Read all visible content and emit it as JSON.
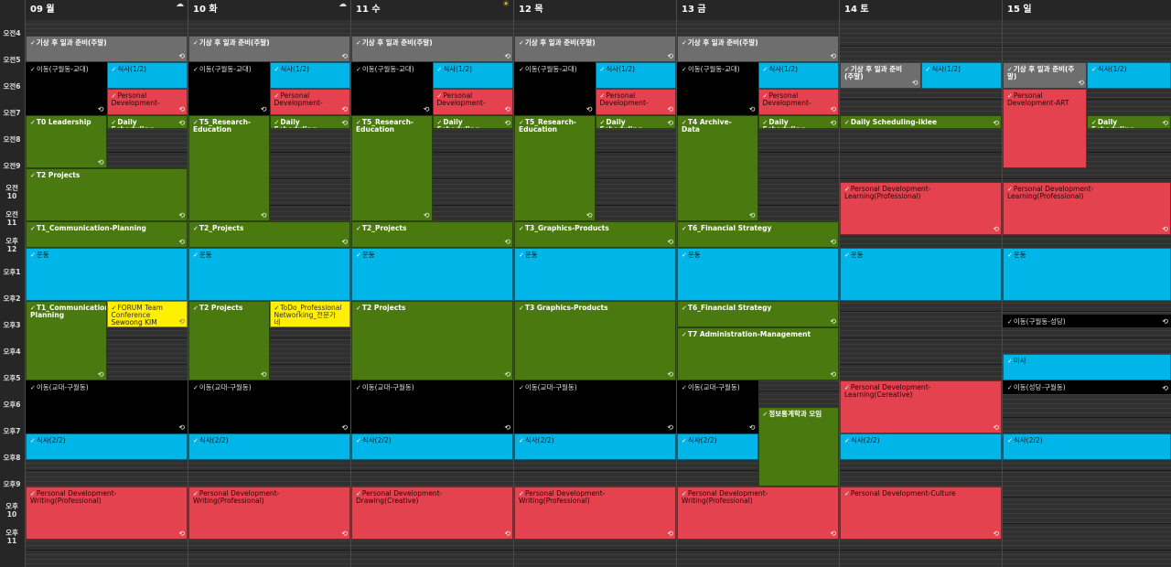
{
  "days": [
    {
      "label": "09 월",
      "weather": "cloud-icon"
    },
    {
      "label": "10 화",
      "weather": "cloud-icon"
    },
    {
      "label": "11 수",
      "weather": "sun-icon"
    },
    {
      "label": "12 목",
      "weather": ""
    },
    {
      "label": "13 금",
      "weather": ""
    },
    {
      "label": "14 토",
      "weather": ""
    },
    {
      "label": "15 일",
      "weather": ""
    }
  ],
  "hours": [
    "오전4",
    "오전5",
    "오전6",
    "오전7",
    "오전8",
    "오전9",
    "오전\n10",
    "오전\n11",
    "오후\n12",
    "오후1",
    "오후2",
    "오후3",
    "오후4",
    "오후5",
    "오후6",
    "오후7",
    "오후8",
    "오후9",
    "오후\n10",
    "오후\n11"
  ],
  "colors": {
    "gray": "#6e6e6e",
    "black": "#000000",
    "blue": "#00b6e9",
    "red": "#e5424f",
    "green": "#4a7a0f",
    "yellow": "#ffef00"
  },
  "icons": {
    "check": "check-icon",
    "sync": "sync-icon"
  },
  "events": [
    {
      "day": 0,
      "start": 4.6,
      "end": 5.6,
      "col": 0,
      "cols": 1,
      "color": "gray",
      "title": "기상 후 일과 준비(주말)",
      "sync": true
    },
    {
      "day": 0,
      "start": 5.6,
      "end": 7.6,
      "col": 0,
      "cols": 2,
      "color": "black",
      "title": "이동(구월동-교대)",
      "sync": true
    },
    {
      "day": 0,
      "start": 5.6,
      "end": 6.6,
      "col": 1,
      "cols": 2,
      "color": "blue",
      "title": "식사(1/2)",
      "sync": false
    },
    {
      "day": 0,
      "start": 6.6,
      "end": 7.6,
      "col": 1,
      "cols": 2,
      "color": "red",
      "title": "Personal Development-",
      "sync": true
    },
    {
      "day": 0,
      "start": 7.6,
      "end": 9.6,
      "col": 0,
      "cols": 2,
      "color": "green",
      "title": "T0 Leadership",
      "sync": true
    },
    {
      "day": 0,
      "start": 7.6,
      "end": 8.1,
      "col": 1,
      "cols": 2,
      "color": "green",
      "title": "Daily Scheduling",
      "sync": true
    },
    {
      "day": 0,
      "start": 9.6,
      "end": 11.6,
      "col": 0,
      "cols": 1,
      "color": "green",
      "title": "T2 Projects",
      "sync": true
    },
    {
      "day": 0,
      "start": 11.6,
      "end": 12.6,
      "col": 0,
      "cols": 1,
      "color": "green",
      "title": "T1_Communication-Planning",
      "sync": true
    },
    {
      "day": 0,
      "start": 12.6,
      "end": 14.6,
      "col": 0,
      "cols": 1,
      "color": "blue",
      "title": "운동",
      "sync": false
    },
    {
      "day": 0,
      "start": 14.6,
      "end": 17.6,
      "col": 0,
      "cols": 2,
      "color": "green",
      "title": "T1_Communication-Planning",
      "sync": true
    },
    {
      "day": 0,
      "start": 14.6,
      "end": 15.6,
      "col": 1,
      "cols": 2,
      "color": "yellow",
      "title": "FORUM Team Conference",
      "sub": "Sewoong KIM",
      "sync": true
    },
    {
      "day": 0,
      "start": 17.6,
      "end": 19.6,
      "col": 0,
      "cols": 1,
      "color": "black",
      "title": "이동(교대-구월동)",
      "sync": true
    },
    {
      "day": 0,
      "start": 19.6,
      "end": 20.6,
      "col": 0,
      "cols": 1,
      "color": "blue",
      "title": "식사(2/2)",
      "sync": false
    },
    {
      "day": 0,
      "start": 21.6,
      "end": 23.6,
      "col": 0,
      "cols": 1,
      "color": "red",
      "title": "Personal Development-Writing(Professional)",
      "sync": true
    },
    {
      "day": 1,
      "start": 4.6,
      "end": 5.6,
      "col": 0,
      "cols": 1,
      "color": "gray",
      "title": "기상 후 일과 준비(주말)",
      "sync": true
    },
    {
      "day": 1,
      "start": 5.6,
      "end": 7.6,
      "col": 0,
      "cols": 2,
      "color": "black",
      "title": "이동(구월동-교대)",
      "sync": true
    },
    {
      "day": 1,
      "start": 5.6,
      "end": 6.6,
      "col": 1,
      "cols": 2,
      "color": "blue",
      "title": "식사(1/2)",
      "sync": false
    },
    {
      "day": 1,
      "start": 6.6,
      "end": 7.6,
      "col": 1,
      "cols": 2,
      "color": "red",
      "title": "Personal Development-",
      "sync": true
    },
    {
      "day": 1,
      "start": 7.6,
      "end": 11.6,
      "col": 0,
      "cols": 2,
      "color": "green",
      "title": "T5_Research-Education",
      "sync": true
    },
    {
      "day": 1,
      "start": 7.6,
      "end": 8.1,
      "col": 1,
      "cols": 2,
      "color": "green",
      "title": "Daily Scheduling",
      "sync": true
    },
    {
      "day": 1,
      "start": 11.6,
      "end": 12.6,
      "col": 0,
      "cols": 1,
      "color": "green",
      "title": "T2_Projects",
      "sync": true
    },
    {
      "day": 1,
      "start": 12.6,
      "end": 14.6,
      "col": 0,
      "cols": 1,
      "color": "blue",
      "title": "운동",
      "sync": false
    },
    {
      "day": 1,
      "start": 14.6,
      "end": 17.6,
      "col": 0,
      "cols": 2,
      "color": "green",
      "title": "T2 Projects",
      "sync": true
    },
    {
      "day": 1,
      "start": 14.6,
      "end": 15.6,
      "col": 1,
      "cols": 2,
      "color": "yellow",
      "title": "ToDo_Professional Networking_전문가네",
      "sync": false
    },
    {
      "day": 1,
      "start": 17.6,
      "end": 19.6,
      "col": 0,
      "cols": 1,
      "color": "black",
      "title": "이동(교대-구월동)",
      "sync": true
    },
    {
      "day": 1,
      "start": 19.6,
      "end": 20.6,
      "col": 0,
      "cols": 1,
      "color": "blue",
      "title": "식사(2/2)",
      "sync": false
    },
    {
      "day": 1,
      "start": 21.6,
      "end": 23.6,
      "col": 0,
      "cols": 1,
      "color": "red",
      "title": "Personal Development-Writing(Professional)",
      "sync": true
    },
    {
      "day": 2,
      "start": 4.6,
      "end": 5.6,
      "col": 0,
      "cols": 1,
      "color": "gray",
      "title": "기상 후 일과 준비(주말)",
      "sync": true
    },
    {
      "day": 2,
      "start": 5.6,
      "end": 7.6,
      "col": 0,
      "cols": 2,
      "color": "black",
      "title": "이동(구월동-교대)",
      "sync": true
    },
    {
      "day": 2,
      "start": 5.6,
      "end": 6.6,
      "col": 1,
      "cols": 2,
      "color": "blue",
      "title": "식사(1/2)",
      "sync": false
    },
    {
      "day": 2,
      "start": 6.6,
      "end": 7.6,
      "col": 1,
      "cols": 2,
      "color": "red",
      "title": "Personal Development-",
      "sync": true
    },
    {
      "day": 2,
      "start": 7.6,
      "end": 11.6,
      "col": 0,
      "cols": 2,
      "color": "green",
      "title": "T5_Research-Education",
      "sync": true
    },
    {
      "day": 2,
      "start": 7.6,
      "end": 8.1,
      "col": 1,
      "cols": 2,
      "color": "green",
      "title": "Daily Scheduling",
      "sync": true
    },
    {
      "day": 2,
      "start": 11.6,
      "end": 12.6,
      "col": 0,
      "cols": 1,
      "color": "green",
      "title": "T2_Projects",
      "sync": true
    },
    {
      "day": 2,
      "start": 12.6,
      "end": 14.6,
      "col": 0,
      "cols": 1,
      "color": "blue",
      "title": "운동",
      "sync": false
    },
    {
      "day": 2,
      "start": 14.6,
      "end": 17.6,
      "col": 0,
      "cols": 1,
      "color": "green",
      "title": "T2 Projects",
      "sync": true
    },
    {
      "day": 2,
      "start": 17.6,
      "end": 19.6,
      "col": 0,
      "cols": 1,
      "color": "black",
      "title": "이동(교대-구월동)",
      "sync": true
    },
    {
      "day": 2,
      "start": 19.6,
      "end": 20.6,
      "col": 0,
      "cols": 1,
      "color": "blue",
      "title": "식사(2/2)",
      "sync": false
    },
    {
      "day": 2,
      "start": 21.6,
      "end": 23.6,
      "col": 0,
      "cols": 1,
      "color": "red",
      "title": "Personal Development-Drawing(Creative)",
      "sync": true
    },
    {
      "day": 3,
      "start": 4.6,
      "end": 5.6,
      "col": 0,
      "cols": 1,
      "color": "gray",
      "title": "기상 후 일과 준비(주말)",
      "sync": true
    },
    {
      "day": 3,
      "start": 5.6,
      "end": 7.6,
      "col": 0,
      "cols": 2,
      "color": "black",
      "title": "이동(구월동-교대)",
      "sync": true
    },
    {
      "day": 3,
      "start": 5.6,
      "end": 6.6,
      "col": 1,
      "cols": 2,
      "color": "blue",
      "title": "식사(1/2)",
      "sync": false
    },
    {
      "day": 3,
      "start": 6.6,
      "end": 7.6,
      "col": 1,
      "cols": 2,
      "color": "red",
      "title": "Personal Development-",
      "sync": true
    },
    {
      "day": 3,
      "start": 7.6,
      "end": 11.6,
      "col": 0,
      "cols": 2,
      "color": "green",
      "title": "T5_Research-Education",
      "sync": true
    },
    {
      "day": 3,
      "start": 7.6,
      "end": 8.1,
      "col": 1,
      "cols": 2,
      "color": "green",
      "title": "Daily Scheduling",
      "sync": true
    },
    {
      "day": 3,
      "start": 11.6,
      "end": 12.6,
      "col": 0,
      "cols": 1,
      "color": "green",
      "title": "T3_Graphics-Products",
      "sync": true
    },
    {
      "day": 3,
      "start": 12.6,
      "end": 14.6,
      "col": 0,
      "cols": 1,
      "color": "blue",
      "title": "운동",
      "sync": false
    },
    {
      "day": 3,
      "start": 14.6,
      "end": 17.6,
      "col": 0,
      "cols": 1,
      "color": "green",
      "title": "T3 Graphics-Products",
      "sync": true
    },
    {
      "day": 3,
      "start": 17.6,
      "end": 19.6,
      "col": 0,
      "cols": 1,
      "color": "black",
      "title": "이동(교대-구월동)",
      "sync": true
    },
    {
      "day": 3,
      "start": 19.6,
      "end": 20.6,
      "col": 0,
      "cols": 1,
      "color": "blue",
      "title": "식사(2/2)",
      "sync": false
    },
    {
      "day": 3,
      "start": 21.6,
      "end": 23.6,
      "col": 0,
      "cols": 1,
      "color": "red",
      "title": "Personal Development-Writing(Professional)",
      "sync": true
    },
    {
      "day": 4,
      "start": 4.6,
      "end": 5.6,
      "col": 0,
      "cols": 1,
      "color": "gray",
      "title": "기상 후 일과 준비(주말)",
      "sync": true
    },
    {
      "day": 4,
      "start": 5.6,
      "end": 7.6,
      "col": 0,
      "cols": 2,
      "color": "black",
      "title": "이동(구월동-교대)",
      "sync": true
    },
    {
      "day": 4,
      "start": 5.6,
      "end": 6.6,
      "col": 1,
      "cols": 2,
      "color": "blue",
      "title": "식사(1/2)",
      "sync": false
    },
    {
      "day": 4,
      "start": 6.6,
      "end": 7.6,
      "col": 1,
      "cols": 2,
      "color": "red",
      "title": "Personal Development-",
      "sync": true
    },
    {
      "day": 4,
      "start": 7.6,
      "end": 11.6,
      "col": 0,
      "cols": 2,
      "color": "green",
      "title": "T4 Archive-Data",
      "sync": true
    },
    {
      "day": 4,
      "start": 7.6,
      "end": 8.1,
      "col": 1,
      "cols": 2,
      "color": "green",
      "title": "Daily Scheduling",
      "sync": true
    },
    {
      "day": 4,
      "start": 11.6,
      "end": 12.6,
      "col": 0,
      "cols": 1,
      "color": "green",
      "title": "T6_Financial Strategy",
      "sync": true
    },
    {
      "day": 4,
      "start": 12.6,
      "end": 14.6,
      "col": 0,
      "cols": 1,
      "color": "blue",
      "title": "운동",
      "sync": false
    },
    {
      "day": 4,
      "start": 14.6,
      "end": 15.6,
      "col": 0,
      "cols": 1,
      "color": "green",
      "title": "T6_Financial Strategy",
      "sync": true
    },
    {
      "day": 4,
      "start": 15.6,
      "end": 17.6,
      "col": 0,
      "cols": 1,
      "color": "green",
      "title": "T7 Administration-Management",
      "sync": true
    },
    {
      "day": 4,
      "start": 17.6,
      "end": 19.6,
      "col": 0,
      "cols": 2,
      "color": "black",
      "title": "이동(교대-구월동)",
      "sync": true
    },
    {
      "day": 4,
      "start": 18.6,
      "end": 21.6,
      "col": 1,
      "cols": 2,
      "color": "green",
      "title": "정보통계학과 모임",
      "sync": false
    },
    {
      "day": 4,
      "start": 19.6,
      "end": 20.6,
      "col": 0,
      "cols": 2,
      "color": "blue",
      "title": "식사(2/2)",
      "sync": false
    },
    {
      "day": 4,
      "start": 21.6,
      "end": 23.6,
      "col": 0,
      "cols": 1,
      "color": "red",
      "title": "Personal Development-Writing(Professional)",
      "sync": true
    },
    {
      "day": 5,
      "start": 5.6,
      "end": 6.6,
      "col": 0,
      "cols": 2,
      "color": "gray",
      "title": "기상 후 일과 준비(주말)",
      "sync": true
    },
    {
      "day": 5,
      "start": 5.6,
      "end": 6.6,
      "col": 1,
      "cols": 2,
      "color": "blue",
      "title": "식사(1/2)",
      "sync": false
    },
    {
      "day": 5,
      "start": 7.6,
      "end": 8.1,
      "col": 0,
      "cols": 1,
      "color": "green",
      "title": "Daily Scheduling-iklee",
      "sync": true
    },
    {
      "day": 5,
      "start": 10.1,
      "end": 12.1,
      "col": 0,
      "cols": 1,
      "color": "red",
      "title": "Personal Development-Learning(Professional)",
      "sync": true
    },
    {
      "day": 5,
      "start": 12.6,
      "end": 14.6,
      "col": 0,
      "cols": 1,
      "color": "blue",
      "title": "운동",
      "sync": false
    },
    {
      "day": 5,
      "start": 17.6,
      "end": 19.6,
      "col": 0,
      "cols": 1,
      "color": "red",
      "title": "Personal Development-Learning(Cereative)",
      "sync": true
    },
    {
      "day": 5,
      "start": 19.6,
      "end": 20.6,
      "col": 0,
      "cols": 1,
      "color": "blue",
      "title": "식사(2/2)",
      "sync": false
    },
    {
      "day": 5,
      "start": 21.6,
      "end": 23.6,
      "col": 0,
      "cols": 1,
      "color": "red",
      "title": "Personal Development-Culture",
      "sync": true
    },
    {
      "day": 6,
      "start": 5.6,
      "end": 6.6,
      "col": 0,
      "cols": 2,
      "color": "gray",
      "title": "기상 후 일과 준비(주말)",
      "sync": true
    },
    {
      "day": 6,
      "start": 5.6,
      "end": 6.6,
      "col": 1,
      "cols": 2,
      "color": "blue",
      "title": "식사(1/2)",
      "sync": false
    },
    {
      "day": 6,
      "start": 6.6,
      "end": 9.6,
      "col": 0,
      "cols": 2,
      "color": "red",
      "title": "Personal Development-ART",
      "sync": false
    },
    {
      "day": 6,
      "start": 7.6,
      "end": 8.1,
      "col": 1,
      "cols": 2,
      "color": "green",
      "title": "Daily Scheduling",
      "sync": true
    },
    {
      "day": 6,
      "start": 10.1,
      "end": 12.1,
      "col": 0,
      "cols": 1,
      "color": "red",
      "title": "Personal Development-Learning(Professional)",
      "sync": true
    },
    {
      "day": 6,
      "start": 12.6,
      "end": 14.6,
      "col": 0,
      "cols": 1,
      "color": "blue",
      "title": "운동",
      "sync": false
    },
    {
      "day": 6,
      "start": 15.1,
      "end": 15.6,
      "col": 0,
      "cols": 1,
      "color": "black",
      "title": "이동(구월동-성당)",
      "sync": true
    },
    {
      "day": 6,
      "start": 16.6,
      "end": 17.6,
      "col": 0,
      "cols": 1,
      "color": "blue",
      "title": "미사",
      "sync": false
    },
    {
      "day": 6,
      "start": 17.6,
      "end": 18.1,
      "col": 0,
      "cols": 1,
      "color": "black",
      "title": "이동(성당-구월동)",
      "sync": true
    },
    {
      "day": 6,
      "start": 19.6,
      "end": 20.6,
      "col": 0,
      "cols": 1,
      "color": "blue",
      "title": "식사(2/2)",
      "sync": false
    }
  ]
}
